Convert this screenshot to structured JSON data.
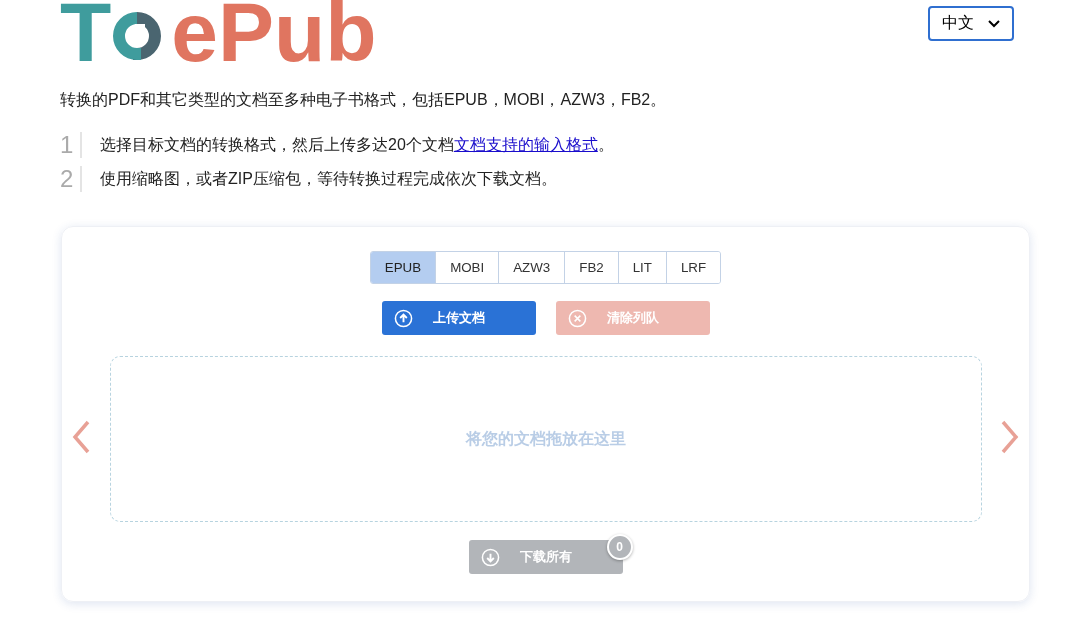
{
  "logo": {
    "prefix": "T",
    "suffix": "ePub"
  },
  "language_select": {
    "value": "中文"
  },
  "intro": "转换的PDF和其它类型的文档至多种电子书格式，包括EPUB，MOBI，AZW3，FB2。",
  "steps": [
    {
      "number": "1",
      "text": "选择目标文档的转换格式，然后上传多达20个文档",
      "link": "文档支持的输入格式",
      "after": "。"
    },
    {
      "number": "2",
      "text": "使用缩略图，或者ZIP压缩包，等待转换过程完成依次下载文档。"
    }
  ],
  "format_tabs": [
    {
      "label": "EPUB",
      "selected": true
    },
    {
      "label": "MOBI",
      "selected": false
    },
    {
      "label": "AZW3",
      "selected": false
    },
    {
      "label": "FB2",
      "selected": false
    },
    {
      "label": "LIT",
      "selected": false
    },
    {
      "label": "LRF",
      "selected": false
    }
  ],
  "upload_button": {
    "label": "上传文档",
    "disabled": false
  },
  "clear_button": {
    "label": "清除列队",
    "disabled": true
  },
  "drop_zone": {
    "placeholder": "将您的文档拖放在这里"
  },
  "download_button": {
    "label": "下载所有",
    "disabled": true,
    "badge": "0"
  }
}
